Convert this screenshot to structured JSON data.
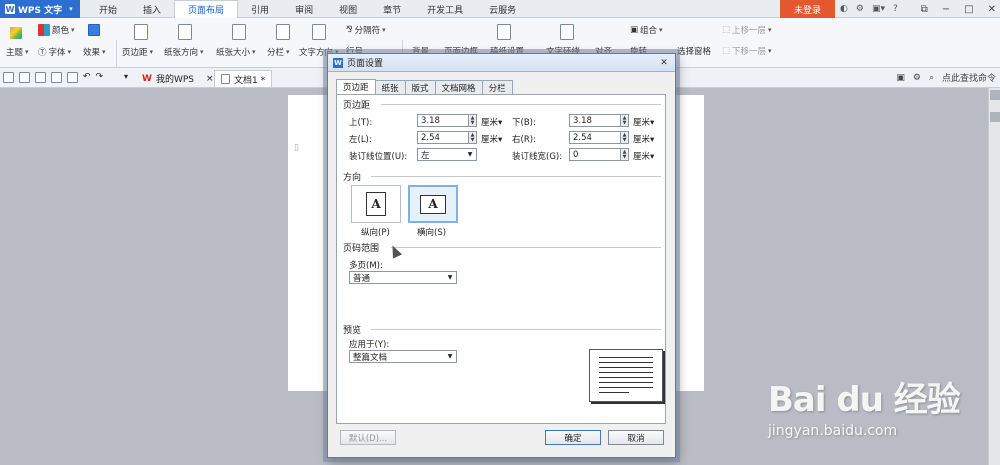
{
  "app": {
    "name": "WPS 文字"
  },
  "menu": [
    "开始",
    "插入",
    "页面布局",
    "引用",
    "审阅",
    "视图",
    "章节",
    "开发工具",
    "云服务"
  ],
  "menu_active": "页面布局",
  "login_label": "未登录",
  "title_icons": [
    "?",
    "−",
    "□",
    "✕"
  ],
  "ribbon": {
    "theme": "主题",
    "colors": "颜色",
    "fonts": "字体",
    "effects": "效果",
    "margins": "页边距",
    "orientation": "纸张方向",
    "size": "纸张大小",
    "columns": "分栏",
    "text_direction": "文字方向",
    "separator": "分隔符",
    "line_number": "行号",
    "background": "背景",
    "page_border": "页面边框",
    "draft_paper": "稿纸设置",
    "wrap": "文字环绕",
    "align": "对齐",
    "rotate": "旋转",
    "group": "组合",
    "selection_pane": "选择窗格",
    "bring_forward": "上移一层",
    "send_backward": "下移一层"
  },
  "doc_tabs": {
    "home": "我的WPS",
    "doc": "文档1 *"
  },
  "right_search": "点此查找命令",
  "dialog": {
    "title": "页面设置",
    "tabs": [
      "页边距",
      "纸张",
      "版式",
      "文档网格",
      "分栏"
    ],
    "active_tab": "页边距",
    "margins_group": "页边距",
    "top_label": "上(T):",
    "top_value": "3.18",
    "bottom_label": "下(B):",
    "bottom_value": "3.18",
    "left_label": "左(L):",
    "left_value": "2.54",
    "right_label": "右(R):",
    "right_value": "2.54",
    "gutter_pos_label": "装订线位置(U):",
    "gutter_pos_value": "左",
    "gutter_label": "装订线宽(G):",
    "gutter_value": "0",
    "unit": "厘米",
    "orientation_group": "方向",
    "portrait_label": "纵向(P)",
    "landscape_label": "横向(S)",
    "orientation_glyph": "A",
    "pages_group": "页码范围",
    "multi_pages_label": "多页(M):",
    "multi_pages_value": "普通",
    "preview_group": "预览",
    "apply_label": "应用于(Y):",
    "apply_value": "整篇文档",
    "default_button": "默认(D)...",
    "ok_button": "确定",
    "cancel_button": "取消"
  },
  "watermark": {
    "main": "Bai du 经验",
    "sub": "jingyan.baidu.com"
  },
  "colors": {
    "accent": "#2c6fd1",
    "login": "#e5572f",
    "selected_border": "#7fb0e6"
  }
}
